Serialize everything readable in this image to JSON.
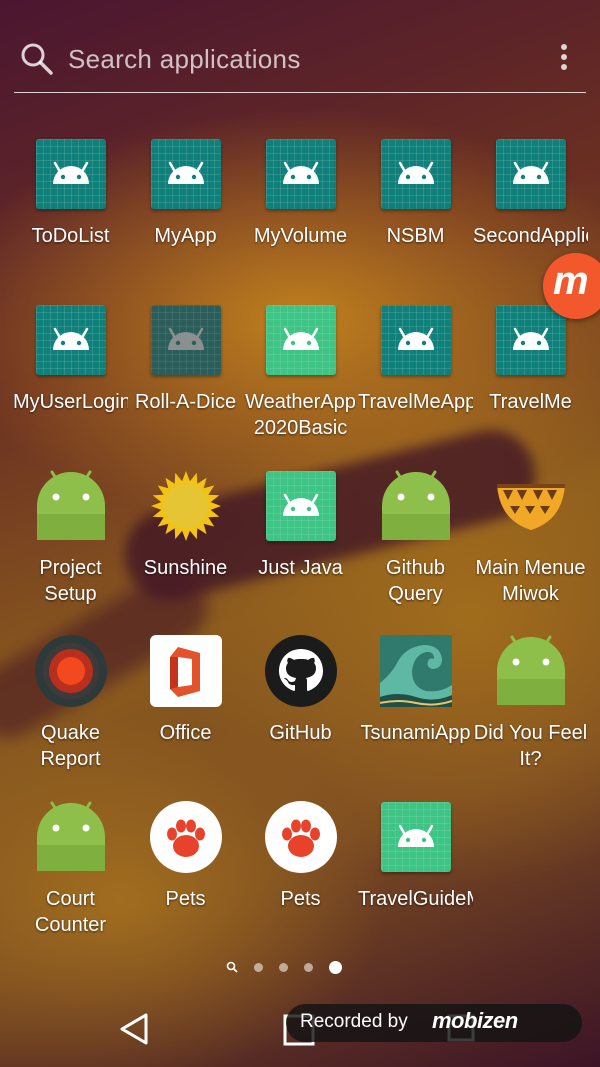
{
  "search": {
    "placeholder": "Search applications"
  },
  "rows": [
    [
      {
        "label": "ToDoList",
        "icon": "teal-android-icon"
      },
      {
        "label": "MyApp",
        "icon": "teal-android-icon"
      },
      {
        "label": "MyVolume",
        "icon": "teal-android-icon"
      },
      {
        "label": "NSBM",
        "icon": "teal-android-icon"
      },
      {
        "label": "SecondApplic",
        "icon": "teal-android-icon"
      }
    ],
    [
      {
        "label": "MyUserLogin",
        "icon": "teal-android-icon"
      },
      {
        "label": "Roll-A-Dice",
        "icon": "dim-android-icon"
      },
      {
        "label": "WeatherApp",
        "label2": "2020Basic",
        "icon": "green-android-icon"
      },
      {
        "label": "TravelMeApp",
        "icon": "teal-android-icon"
      },
      {
        "label": "TravelMe",
        "icon": "teal-android-icon"
      }
    ],
    [
      {
        "label": "Project",
        "label2": "Setup",
        "icon": "android-robot-icon"
      },
      {
        "label": "Sunshine",
        "icon": "sun-icon"
      },
      {
        "label": "Just Java",
        "icon": "green-android-icon"
      },
      {
        "label": "Github",
        "label2": "Query",
        "icon": "android-robot-icon"
      },
      {
        "label": "Main Menue",
        "label2": "Miwok",
        "icon": "miwok-basket-icon"
      }
    ],
    [
      {
        "label": "Quake",
        "label2": "Report",
        "icon": "quake-target-icon"
      },
      {
        "label": "Office",
        "icon": "office-icon"
      },
      {
        "label": "GitHub",
        "icon": "github-icon"
      },
      {
        "label": "TsunamiApp",
        "icon": "wave-icon"
      },
      {
        "label": "Did You Feel",
        "label2": "It?",
        "icon": "android-robot-icon"
      }
    ],
    [
      {
        "label": "Court",
        "label2": "Counter",
        "icon": "android-robot-icon"
      },
      {
        "label": "Pets",
        "icon": "paw-icon"
      },
      {
        "label": "Pets",
        "icon": "paw-icon"
      },
      {
        "label": "TravelGuideM",
        "icon": "green-android-icon"
      }
    ]
  ],
  "pager": {
    "page_count": 5,
    "active_page": 4
  },
  "recorder": {
    "text": "Recorded by",
    "logo": "mobizen"
  },
  "bubble": {
    "letter": "m"
  },
  "colors": {
    "teal": "#10807a",
    "green": "#3ec484",
    "robot": "#8dbf4a",
    "orange": "#f3582d"
  }
}
